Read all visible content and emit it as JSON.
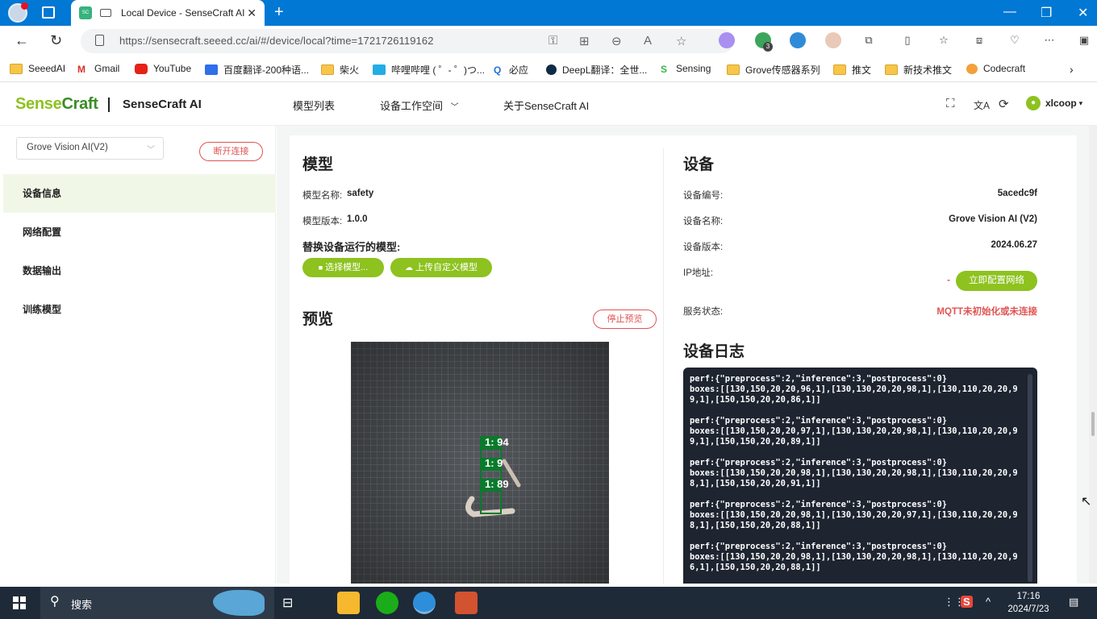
{
  "browser": {
    "tab_title": "Local Device - SenseCraft AI",
    "tab_close": "✕",
    "new_tab": "+",
    "url": "https://sensecraft.seeed.cc/ai/#/device/local?time=1721726119162",
    "bookmarks": [
      "SeeedAI",
      "Gmail",
      "YouTube",
      "百度翻译-200种语...",
      "柴火",
      "哔哩哔哩 ( ゜- ゜)つ...",
      "必应",
      "DeepL翻译：全世...",
      "Sensing",
      "Grove传感器系列",
      "推文",
      "新技术推文",
      "Codecraft"
    ],
    "ext_badge": "3"
  },
  "app": {
    "logo_a": "Sense",
    "logo_b": "Craft",
    "title": "SenseCraft AI",
    "nav": [
      "模型列表",
      "设备工作空间",
      "关于SenseCraft AI"
    ],
    "user": "xlcoop"
  },
  "sidebar": {
    "device_select": "Grove Vision AI(V2)",
    "disconnect": "断开连接",
    "items": [
      "设备信息",
      "网络配置",
      "数据输出",
      "训练模型"
    ]
  },
  "model": {
    "heading": "模型",
    "name_label": "模型名称:",
    "name": "safety",
    "version_label": "模型版本:",
    "version": "1.0.0",
    "replace_heading": "替换设备运行的模型:",
    "select_btn": "选择模型...",
    "upload_btn": "上传自定义模型"
  },
  "preview": {
    "heading": "预览",
    "stop_btn": "停止预览",
    "labels": [
      "1: 94",
      "1: 9",
      "1: 89"
    ]
  },
  "device": {
    "heading": "设备",
    "id_label": "设备编号:",
    "id": "5acedc9f",
    "name_label": "设备名称:",
    "name": "Grove Vision AI (V2)",
    "version_label": "设备版本:",
    "version": "2024.06.27",
    "ip_label": "IP地址:",
    "ip": "-",
    "config_btn": "立即配置网络",
    "service_label": "服务状态:",
    "service": "MQTT未初始化或未连接"
  },
  "log": {
    "heading": "设备日志",
    "entries": [
      "perf:{\"preprocess\":2,\"inference\":3,\"postprocess\":0}\nboxes:[[130,150,20,20,96,1],[130,130,20,20,98,1],[130,110,20,20,99,1],[150,150,20,20,86,1]]",
      "perf:{\"preprocess\":2,\"inference\":3,\"postprocess\":0}\nboxes:[[130,150,20,20,97,1],[130,130,20,20,98,1],[130,110,20,20,99,1],[150,150,20,20,89,1]]",
      "perf:{\"preprocess\":2,\"inference\":3,\"postprocess\":0}\nboxes:[[130,150,20,20,98,1],[130,130,20,20,98,1],[130,110,20,20,98,1],[150,150,20,20,91,1]]",
      "perf:{\"preprocess\":2,\"inference\":3,\"postprocess\":0}\nboxes:[[130,150,20,20,98,1],[130,130,20,20,97,1],[130,110,20,20,98,1],[150,150,20,20,88,1]]",
      "perf:{\"preprocess\":2,\"inference\":3,\"postprocess\":0}\nboxes:[[130,150,20,20,98,1],[130,130,20,20,98,1],[130,110,20,20,96,1],[150,150,20,20,88,1]]"
    ]
  },
  "taskbar": {
    "search": "搜索",
    "time": "17:16",
    "date": "2024/7/23"
  },
  "colors": {
    "accent": "#8dc21f",
    "danger": "#e05454",
    "log_bg": "#1e2430"
  }
}
